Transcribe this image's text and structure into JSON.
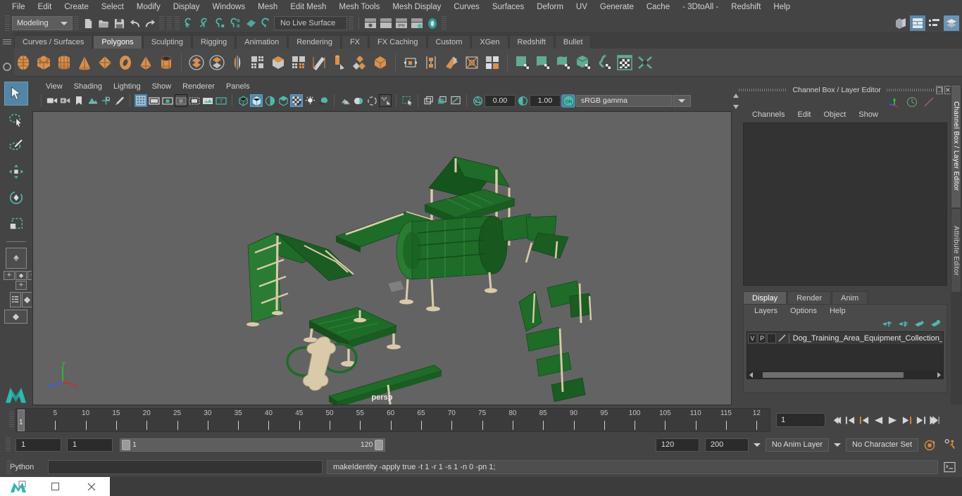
{
  "app": {
    "title": "Autodesk Maya"
  },
  "menubar": {
    "items": [
      "File",
      "Edit",
      "Create",
      "Select",
      "Modify",
      "Display",
      "Windows",
      "Mesh",
      "Edit Mesh",
      "Mesh Tools",
      "Mesh Display",
      "Curves",
      "Surfaces",
      "Deform",
      "UV",
      "Generate",
      "Cache",
      "- 3DtoAll -",
      "Redshift",
      "Help"
    ]
  },
  "statusline": {
    "mode": "Modeling",
    "live_surface": "No Live Surface",
    "icons": [
      "new-scene-icon",
      "open-scene-icon",
      "save-scene-icon",
      "undo-icon",
      "redo-icon",
      "snap-grid-icon",
      "snap-curve-icon",
      "snap-point-icon",
      "snap-projected-center-icon",
      "snap-view-plane-icon",
      "make-live-icon",
      "render-view-icon",
      "render-region-icon",
      "ipr-render-icon",
      "render-settings-icon",
      "hypershade-icon",
      "outliner-icon",
      "node-editor-icon",
      "attribute-spreadsheet-icon",
      "layer-editor-icon"
    ]
  },
  "shelf": {
    "tabs": [
      "Curves / Surfaces",
      "Polygons",
      "Sculpting",
      "Rigging",
      "Animation",
      "Rendering",
      "FX",
      "FX Caching",
      "Custom",
      "XGen",
      "Redshift",
      "Bullet"
    ],
    "active_tab": "Polygons",
    "icons": [
      "poly-sphere-icon",
      "poly-cube-icon",
      "poly-cylinder-icon",
      "poly-cone-icon",
      "poly-plane-icon",
      "poly-torus-icon",
      "poly-pyramid-icon",
      "poly-pipe-icon",
      "poly-combine-icon",
      "poly-separate-icon",
      "poly-mirror-icon",
      "poly-smooth-icon",
      "poly-boolean-icon",
      "poly-reduce-icon",
      "poly-multicut-icon",
      "poly-extrude-icon",
      "poly-bevel-icon",
      "poly-bridge-icon",
      "poly-append-icon",
      "poly-insert-edge-loop-icon",
      "poly-offset-edge-loop-icon",
      "poly-target-weld-icon",
      "poly-quad-draw-icon",
      "uv-planar-icon",
      "uv-cylindrical-icon",
      "uv-spherical-icon",
      "uv-automatic-icon",
      "uv-unfold-icon",
      "uv-editor-icon",
      "uv-layout-icon"
    ]
  },
  "toolbox": {
    "tools": [
      "select-tool",
      "lasso-select-tool",
      "paint-select-tool",
      "move-tool",
      "rotate-tool",
      "scale-tool"
    ],
    "active_tool": "select-tool",
    "layouts": [
      "single-perspective-view-layout",
      "four-view-layout",
      "outliner-persp-layout",
      "hypergraph-persp-layout"
    ],
    "logo": "maya-logo-icon"
  },
  "viewport": {
    "menus": [
      "View",
      "Shading",
      "Lighting",
      "Show",
      "Renderer",
      "Panels"
    ],
    "camera_label": "persp",
    "exposure": "0.00",
    "gamma": "1.00",
    "color_space": "sRGB gamma",
    "toggles": [
      "select-camera-icon",
      "bookmark-icon",
      "image-plane-icon",
      "two-d-pan-zoom-icon",
      "grease-pencil-icon",
      "grid-toggle-icon",
      "film-gate-icon",
      "resolution-gate-icon",
      "gate-mask-icon",
      "film-origin-icon",
      "safe-action-icon",
      "xray-toggle-icon",
      "wireframe-shading-icon",
      "smooth-shading-icon",
      "shaded-wireframe-icon",
      "textured-icon",
      "use-all-lights-icon",
      "shadows-icon",
      "ambient-occlusion-icon",
      "motion-blur-icon",
      "multisample-icon",
      "depth-of-field-icon",
      "isolate-select-icon",
      "grid-display-icon",
      "filter-icon",
      "xray-joints-icon",
      "exposure-icon",
      "gamma-icon",
      "color-management-icon"
    ],
    "axis": {
      "x": "x",
      "y": "y",
      "z": "z"
    },
    "scene_description": "Dog training agility equipment collection - green and tan obstacles"
  },
  "right_panel": {
    "title": "Channel Box / Layer Editor",
    "channel_menus": [
      "Channels",
      "Edit",
      "Object",
      "Show"
    ],
    "layer_editor": {
      "tabs": [
        "Display",
        "Render",
        "Anim"
      ],
      "active_tab": "Display",
      "menus": [
        "Layers",
        "Options",
        "Help"
      ],
      "buttons": [
        "move-layer-up-icon",
        "move-layer-down-icon",
        "new-layer-icon",
        "new-layer-from-selection-icon"
      ],
      "layers": [
        {
          "visible": "V",
          "playback": "P",
          "shade": "",
          "color_swatch": "#c8c8c8",
          "name": "Dog_Training_Area_Equipment_Collection_("
        }
      ]
    },
    "vertical_tabs": [
      "Channel Box / Layer Editor",
      "Attribute Editor"
    ],
    "active_vertical_tab": "Channel Box / Layer Editor"
  },
  "timeline": {
    "labels": [
      5,
      10,
      15,
      20,
      25,
      30,
      35,
      40,
      45,
      50,
      55,
      60,
      65,
      70,
      75,
      80,
      85,
      90,
      95,
      100,
      105,
      110,
      115,
      "12"
    ],
    "current_frame": "1",
    "current_frame_field": "1",
    "playback_buttons": [
      "go-to-start-icon",
      "step-back-keyframe-icon",
      "step-back-frame-icon",
      "play-backwards-icon",
      "play-forwards-icon",
      "step-forward-frame-icon",
      "step-forward-keyframe-icon",
      "go-to-end-icon"
    ]
  },
  "range": {
    "start_field": "1",
    "range_start_field": "1",
    "slider_start": "1",
    "slider_end": "120",
    "range_end_field": "120",
    "end_field": "200",
    "anim_layer": "No Anim Layer",
    "character_set": "No Character Set",
    "icons": [
      "auto-keyframe-icon",
      "animation-preferences-icon"
    ]
  },
  "command_line": {
    "language": "Python",
    "input_value": "",
    "output": "makeIdentity -apply true -t 1 -r 1 -s 1 -n 0 -pn 1;",
    "script_editor_button": "script-editor-icon"
  },
  "taskbar": {
    "items": [
      "maya-app-icon",
      "restore-window-icon",
      "minimize-window-icon",
      "close-window-icon"
    ]
  },
  "colors": {
    "accent_blue": "#4f88ab",
    "shelf_orange": "#d89050",
    "shelf_teal": "#62ab92",
    "viewport_bg": "#636363",
    "model_green": "#1f6b28",
    "model_tan": "#d9cbaa",
    "panel_bg": "#444444"
  }
}
